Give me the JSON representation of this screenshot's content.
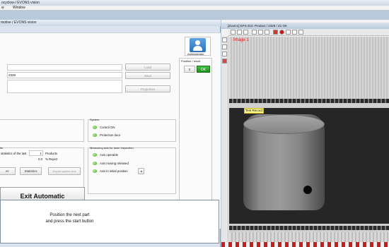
{
  "window": {
    "title": "ocyclow-/ EVONS vision"
  },
  "menu": {
    "items": [
      "w",
      "Window"
    ]
  },
  "app": {
    "subtitle": "motive / EVONS vision",
    "user": {
      "name": "Administrator"
    },
    "position_result": {
      "label": "Position / result",
      "ok_label": "OK",
      "small_btn": "0"
    },
    "fields": {
      "number": "2328"
    },
    "buttons": {
      "load": "Load",
      "save": "Save",
      "properties": "Properties",
      "statistics": "Statistics",
      "export_system_text": "Export system text",
      "reset_fragment": "et",
      "exit_automatic": "Exit Automatic"
    },
    "system": {
      "title": "System",
      "items": [
        "Control ON",
        "Protection door"
      ]
    },
    "results": {
      "title": "lts",
      "stats_label": "statistics of the last",
      "count_value": "1",
      "count_unit": "Products",
      "reject_value": "0.0",
      "reject_unit": "% Reject"
    },
    "measuring": {
      "title": "Measuring axis for laser inspection",
      "items": [
        "Axis operable",
        "Axis moving released",
        "Axis in initial position"
      ],
      "arrow": "◂"
    },
    "message": {
      "line1": "Position the next part",
      "line2": "and press the start button"
    }
  },
  "image_window": {
    "title": "[Zoom1] EPS 810: Product / 2328 / Z1 OK",
    "image_label": "Image 1",
    "roi_label": "Test Record"
  },
  "colors": {
    "ok_green": "#1e8f1e",
    "led_green": "#3d9a1f",
    "label_red": "#e11111",
    "roi_yellow": "#fff68a"
  }
}
